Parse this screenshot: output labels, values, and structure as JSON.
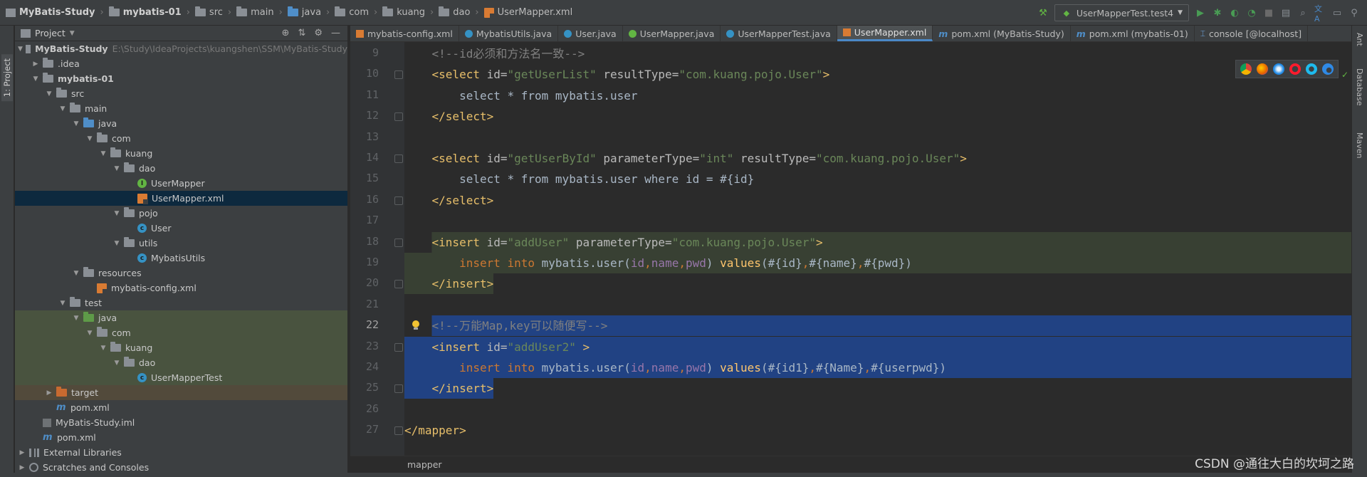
{
  "breadcrumb": [
    {
      "label": "MyBatis-Study",
      "bold": true,
      "icon": "project-icon"
    },
    {
      "label": "mybatis-01",
      "bold": true,
      "icon": "folder-icon"
    },
    {
      "label": "src",
      "bold": false,
      "icon": "folder-icon"
    },
    {
      "label": "main",
      "bold": false,
      "icon": "folder-icon"
    },
    {
      "label": "java",
      "bold": false,
      "icon": "folder-blue-icon"
    },
    {
      "label": "com",
      "bold": false,
      "icon": "folder-icon"
    },
    {
      "label": "kuang",
      "bold": false,
      "icon": "folder-icon"
    },
    {
      "label": "dao",
      "bold": false,
      "icon": "folder-icon"
    },
    {
      "label": "UserMapper.xml",
      "bold": false,
      "icon": "xml-icon"
    }
  ],
  "toolbar": {
    "run_config": "UserMapperTest.test4"
  },
  "sidebar": {
    "project_tab": "1: Project"
  },
  "project_panel": {
    "title": "Project",
    "tree": [
      {
        "label": "MyBatis-Study",
        "extra": "E:\\Study\\IdeaProjects\\kuangshen\\SSM\\MyBatis-Study",
        "depth": 0,
        "arrow": "down",
        "icon": "project-icon",
        "bold": true,
        "state": ""
      },
      {
        "label": ".idea",
        "extra": "",
        "depth": 1,
        "arrow": "right",
        "icon": "folder-icon",
        "bold": false,
        "state": ""
      },
      {
        "label": "mybatis-01",
        "extra": "",
        "depth": 1,
        "arrow": "down",
        "icon": "folder-icon",
        "bold": true,
        "state": ""
      },
      {
        "label": "src",
        "extra": "",
        "depth": 2,
        "arrow": "down",
        "icon": "folder-icon",
        "bold": false,
        "state": ""
      },
      {
        "label": "main",
        "extra": "",
        "depth": 3,
        "arrow": "down",
        "icon": "folder-icon",
        "bold": false,
        "state": ""
      },
      {
        "label": "java",
        "extra": "",
        "depth": 4,
        "arrow": "down",
        "icon": "folder-blue-icon",
        "bold": false,
        "state": ""
      },
      {
        "label": "com",
        "extra": "",
        "depth": 5,
        "arrow": "down",
        "icon": "folder-icon",
        "bold": false,
        "state": ""
      },
      {
        "label": "kuang",
        "extra": "",
        "depth": 6,
        "arrow": "down",
        "icon": "folder-icon",
        "bold": false,
        "state": ""
      },
      {
        "label": "dao",
        "extra": "",
        "depth": 7,
        "arrow": "down",
        "icon": "folder-icon",
        "bold": false,
        "state": ""
      },
      {
        "label": "UserMapper",
        "extra": "",
        "depth": 8,
        "arrow": "",
        "icon": "interface-icon",
        "bold": false,
        "state": ""
      },
      {
        "label": "UserMapper.xml",
        "extra": "",
        "depth": 8,
        "arrow": "",
        "icon": "xml-icon",
        "bold": false,
        "state": "selected"
      },
      {
        "label": "pojo",
        "extra": "",
        "depth": 7,
        "arrow": "down",
        "icon": "folder-icon",
        "bold": false,
        "state": ""
      },
      {
        "label": "User",
        "extra": "",
        "depth": 8,
        "arrow": "",
        "icon": "class-icon",
        "bold": false,
        "state": ""
      },
      {
        "label": "utils",
        "extra": "",
        "depth": 7,
        "arrow": "down",
        "icon": "folder-icon",
        "bold": false,
        "state": ""
      },
      {
        "label": "MybatisUtils",
        "extra": "",
        "depth": 8,
        "arrow": "",
        "icon": "class-icon",
        "bold": false,
        "state": ""
      },
      {
        "label": "resources",
        "extra": "",
        "depth": 4,
        "arrow": "down",
        "icon": "folder-res-icon",
        "bold": false,
        "state": ""
      },
      {
        "label": "mybatis-config.xml",
        "extra": "",
        "depth": 5,
        "arrow": "",
        "icon": "xml-icon",
        "bold": false,
        "state": ""
      },
      {
        "label": "test",
        "extra": "",
        "depth": 3,
        "arrow": "down",
        "icon": "folder-icon",
        "bold": false,
        "state": ""
      },
      {
        "label": "java",
        "extra": "",
        "depth": 4,
        "arrow": "down",
        "icon": "folder-green-icon",
        "bold": false,
        "state": "test"
      },
      {
        "label": "com",
        "extra": "",
        "depth": 5,
        "arrow": "down",
        "icon": "folder-icon",
        "bold": false,
        "state": "test"
      },
      {
        "label": "kuang",
        "extra": "",
        "depth": 6,
        "arrow": "down",
        "icon": "folder-icon",
        "bold": false,
        "state": "test"
      },
      {
        "label": "dao",
        "extra": "",
        "depth": 7,
        "arrow": "down",
        "icon": "folder-icon",
        "bold": false,
        "state": "test"
      },
      {
        "label": "UserMapperTest",
        "extra": "",
        "depth": 8,
        "arrow": "",
        "icon": "class-icon",
        "bold": false,
        "state": "test"
      },
      {
        "label": "target",
        "extra": "",
        "depth": 2,
        "arrow": "right",
        "icon": "folder-orange-icon",
        "bold": false,
        "state": "target"
      },
      {
        "label": "pom.xml",
        "extra": "",
        "depth": 2,
        "arrow": "",
        "icon": "maven-icon",
        "bold": false,
        "state": ""
      },
      {
        "label": "MyBatis-Study.iml",
        "extra": "",
        "depth": 1,
        "arrow": "",
        "icon": "iml-icon",
        "bold": false,
        "state": ""
      },
      {
        "label": "pom.xml",
        "extra": "",
        "depth": 1,
        "arrow": "",
        "icon": "maven-icon",
        "bold": false,
        "state": ""
      },
      {
        "label": "External Libraries",
        "extra": "",
        "depth": 0,
        "arrow": "right",
        "icon": "library-icon",
        "bold": false,
        "state": ""
      },
      {
        "label": "Scratches and Consoles",
        "extra": "",
        "depth": 0,
        "arrow": "right",
        "icon": "scratches-icon",
        "bold": false,
        "state": ""
      }
    ]
  },
  "editor_tabs": [
    {
      "label": "mybatis-config.xml",
      "icon": "xml",
      "active": false
    },
    {
      "label": "MybatisUtils.java",
      "icon": "class",
      "active": false
    },
    {
      "label": "User.java",
      "icon": "class",
      "active": false
    },
    {
      "label": "UserMapper.java",
      "icon": "interface",
      "active": false
    },
    {
      "label": "UserMapperTest.java",
      "icon": "class",
      "active": false
    },
    {
      "label": "UserMapper.xml",
      "icon": "xml",
      "active": true
    },
    {
      "label": "pom.xml (MyBatis-Study)",
      "icon": "maven",
      "active": false
    },
    {
      "label": "pom.xml (mybatis-01)",
      "icon": "maven",
      "active": false
    },
    {
      "label": "console [@localhost]",
      "icon": "db",
      "active": false
    }
  ],
  "code_lines": [
    {
      "n": "9",
      "hl": "",
      "fold": false,
      "bulb": false,
      "tokens": [
        [
          "t-txt",
          "    "
        ],
        [
          "t-com",
          "<!--id必须和方法名一致-->"
        ]
      ]
    },
    {
      "n": "10",
      "hl": "",
      "fold": true,
      "bulb": false,
      "tokens": [
        [
          "t-txt",
          "    "
        ],
        [
          "t-tag",
          "<select "
        ],
        [
          "t-attr",
          "id="
        ],
        [
          "t-val",
          "\"getUserList\" "
        ],
        [
          "t-attr",
          "resultType="
        ],
        [
          "t-val",
          "\"com.kuang.pojo.User\""
        ],
        [
          "t-tag",
          ">"
        ]
      ]
    },
    {
      "n": "11",
      "hl": "",
      "fold": false,
      "bulb": false,
      "tokens": [
        [
          "t-txt",
          "        select * from mybatis.user"
        ]
      ]
    },
    {
      "n": "12",
      "hl": "",
      "fold": true,
      "bulb": false,
      "tokens": [
        [
          "t-txt",
          "    "
        ],
        [
          "t-tag",
          "</select>"
        ]
      ]
    },
    {
      "n": "13",
      "hl": "",
      "fold": false,
      "bulb": false,
      "tokens": [
        [
          "t-txt",
          ""
        ]
      ]
    },
    {
      "n": "14",
      "hl": "",
      "fold": true,
      "bulb": false,
      "tokens": [
        [
          "t-txt",
          "    "
        ],
        [
          "t-tag",
          "<select "
        ],
        [
          "t-attr",
          "id="
        ],
        [
          "t-val",
          "\"getUserById\" "
        ],
        [
          "t-attr",
          "parameterType="
        ],
        [
          "t-val",
          "\"int\" "
        ],
        [
          "t-attr",
          "resultType="
        ],
        [
          "t-val",
          "\"com.kuang.pojo.User\""
        ],
        [
          "t-tag",
          ">"
        ]
      ]
    },
    {
      "n": "15",
      "hl": "",
      "fold": false,
      "bulb": false,
      "tokens": [
        [
          "t-txt",
          "        select * from mybatis.user where id = #{id}"
        ]
      ]
    },
    {
      "n": "16",
      "hl": "",
      "fold": true,
      "bulb": false,
      "tokens": [
        [
          "t-txt",
          "    "
        ],
        [
          "t-tag",
          "</select>"
        ]
      ]
    },
    {
      "n": "17",
      "hl": "",
      "fold": false,
      "bulb": false,
      "tokens": [
        [
          "t-txt",
          ""
        ]
      ]
    },
    {
      "n": "18",
      "hl": "green-partial",
      "fold": true,
      "bulb": false,
      "tokens": [
        [
          "t-txt",
          "    "
        ],
        [
          "t-tag",
          "<insert "
        ],
        [
          "t-attr",
          "id="
        ],
        [
          "t-val",
          "\"addUser\" "
        ],
        [
          "t-attr",
          "parameterType="
        ],
        [
          "t-val",
          "\"com.kuang.pojo.User\""
        ],
        [
          "t-tag",
          ">"
        ]
      ]
    },
    {
      "n": "19",
      "hl": "green",
      "fold": false,
      "bulb": false,
      "tokens": [
        [
          "t-txt",
          "        "
        ],
        [
          "t-kw",
          "insert into "
        ],
        [
          "t-txt",
          "mybatis.user("
        ],
        [
          "t-var",
          "id"
        ],
        [
          "t-kw",
          ","
        ],
        [
          "t-var",
          "name"
        ],
        [
          "t-kw",
          ","
        ],
        [
          "t-var",
          "pwd"
        ],
        [
          "t-txt",
          ") "
        ],
        [
          "t-fn",
          "values"
        ],
        [
          "t-txt",
          "(#{id}"
        ],
        [
          "t-kw",
          ","
        ],
        [
          "t-txt",
          "#{name}"
        ],
        [
          "t-kw",
          ","
        ],
        [
          "t-txt",
          "#{pwd})"
        ]
      ]
    },
    {
      "n": "20",
      "hl": "green-short",
      "fold": true,
      "bulb": false,
      "tokens": [
        [
          "t-txt",
          "    "
        ],
        [
          "t-tag",
          "</insert>"
        ]
      ]
    },
    {
      "n": "21",
      "hl": "",
      "fold": false,
      "bulb": false,
      "tokens": [
        [
          "t-txt",
          ""
        ]
      ]
    },
    {
      "n": "22",
      "hl": "sel-from",
      "fold": false,
      "bulb": true,
      "tokens": [
        [
          "t-txt",
          "    "
        ],
        [
          "t-com",
          "<!--万能Map,key可以随便写-->"
        ]
      ]
    },
    {
      "n": "23",
      "hl": "sel",
      "fold": true,
      "bulb": false,
      "tokens": [
        [
          "t-txt",
          "    "
        ],
        [
          "t-tag",
          "<insert "
        ],
        [
          "t-attr",
          "id="
        ],
        [
          "t-val",
          "\"addUser2\" "
        ],
        [
          "t-tag",
          ">"
        ]
      ]
    },
    {
      "n": "24",
      "hl": "sel",
      "fold": false,
      "bulb": false,
      "tokens": [
        [
          "t-txt",
          "        "
        ],
        [
          "t-kw",
          "insert into "
        ],
        [
          "t-txt",
          "mybatis.user("
        ],
        [
          "t-var",
          "id"
        ],
        [
          "t-kw",
          ","
        ],
        [
          "t-var",
          "name"
        ],
        [
          "t-kw",
          ","
        ],
        [
          "t-var",
          "pwd"
        ],
        [
          "t-txt",
          ") "
        ],
        [
          "t-fn",
          "values"
        ],
        [
          "t-txt",
          "(#{id1}"
        ],
        [
          "t-kw",
          ","
        ],
        [
          "t-txt",
          "#{Name}"
        ],
        [
          "t-kw",
          ","
        ],
        [
          "t-txt",
          "#{userpwd})"
        ]
      ]
    },
    {
      "n": "25",
      "hl": "sel-to",
      "fold": true,
      "bulb": false,
      "tokens": [
        [
          "t-txt",
          "    "
        ],
        [
          "t-tag",
          "</insert>"
        ]
      ]
    },
    {
      "n": "26",
      "hl": "",
      "fold": false,
      "bulb": false,
      "tokens": [
        [
          "t-txt",
          ""
        ]
      ]
    },
    {
      "n": "27",
      "hl": "",
      "fold": true,
      "bulb": false,
      "tokens": [
        [
          "t-tag",
          "</mapper>"
        ]
      ]
    }
  ],
  "current_line": "22",
  "right_tools": [
    "Ant",
    "Database",
    "Maven"
  ],
  "status": {
    "breadcrumb": "mapper"
  },
  "watermark": "CSDN @通往大白的坎坷之路",
  "colors": {
    "selection": "#214283",
    "accent": "#4a88c7",
    "diff_added": "#384033"
  }
}
